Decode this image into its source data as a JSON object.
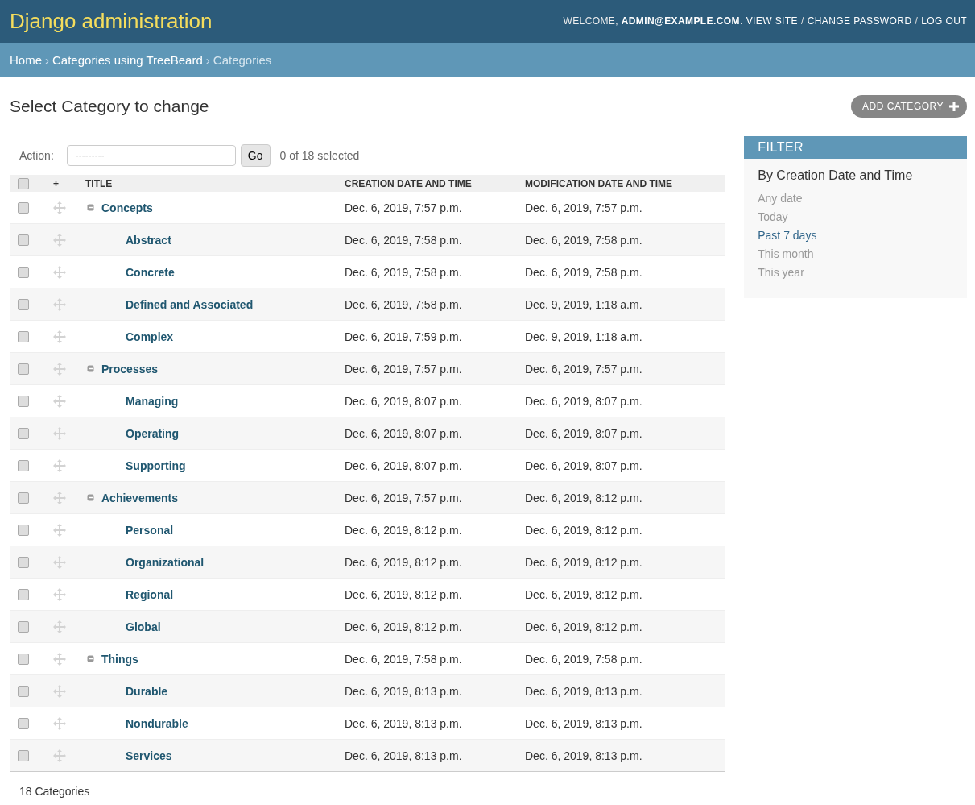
{
  "header": {
    "brand": "Django administration",
    "welcome": "WELCOME,",
    "user": "ADMIN@EXAMPLE.COM",
    "user_end": ".",
    "links": [
      "VIEW SITE",
      "CHANGE PASSWORD",
      "LOG OUT"
    ],
    "separators": [
      "/",
      "/"
    ]
  },
  "breadcrumbs": [
    "Home",
    "Categories using TreeBeard",
    "Categories"
  ],
  "breadcrumb_separators": [
    "›",
    "›"
  ],
  "page_title": "Select Category to change",
  "add_button": "ADD CATEGORY",
  "actions": {
    "label": "Action:",
    "value": "---------",
    "go": "Go",
    "counter": "0 of 18 selected"
  },
  "table": {
    "columns": [
      {
        "label": "+"
      },
      {
        "label": "TITLE"
      },
      {
        "label": "CREATION DATE AND TIME"
      },
      {
        "label": "MODIFICATION DATE AND TIME"
      }
    ],
    "all_checked": false,
    "rows": [
      {
        "title": "Concepts",
        "created": "Dec. 6, 2019, 7:57 p.m.",
        "modified": "Dec. 6, 2019, 7:57 p.m.",
        "checked": false,
        "expanded": true,
        "children": [
          {
            "title": "Abstract",
            "created": "Dec. 6, 2019, 7:58 p.m.",
            "modified": "Dec. 6, 2019, 7:58 p.m.",
            "checked": false
          },
          {
            "title": "Concrete",
            "created": "Dec. 6, 2019, 7:58 p.m.",
            "modified": "Dec. 6, 2019, 7:58 p.m.",
            "checked": false
          },
          {
            "title": "Defined and Associated",
            "created": "Dec. 6, 2019, 7:58 p.m.",
            "modified": "Dec. 9, 2019, 1:18 a.m.",
            "checked": false
          },
          {
            "title": "Complex",
            "created": "Dec. 6, 2019, 7:59 p.m.",
            "modified": "Dec. 9, 2019, 1:18 a.m.",
            "checked": false
          }
        ]
      },
      {
        "title": "Processes",
        "created": "Dec. 6, 2019, 7:57 p.m.",
        "modified": "Dec. 6, 2019, 7:57 p.m.",
        "checked": false,
        "expanded": true,
        "children": [
          {
            "title": "Managing",
            "created": "Dec. 6, 2019, 8:07 p.m.",
            "modified": "Dec. 6, 2019, 8:07 p.m.",
            "checked": false
          },
          {
            "title": "Operating",
            "created": "Dec. 6, 2019, 8:07 p.m.",
            "modified": "Dec. 6, 2019, 8:07 p.m.",
            "checked": false
          },
          {
            "title": "Supporting",
            "created": "Dec. 6, 2019, 8:07 p.m.",
            "modified": "Dec. 6, 2019, 8:07 p.m.",
            "checked": false
          }
        ]
      },
      {
        "title": "Achievements",
        "created": "Dec. 6, 2019, 7:57 p.m.",
        "modified": "Dec. 6, 2019, 8:12 p.m.",
        "checked": false,
        "expanded": true,
        "children": [
          {
            "title": "Personal",
            "created": "Dec. 6, 2019, 8:12 p.m.",
            "modified": "Dec. 6, 2019, 8:12 p.m.",
            "checked": false
          },
          {
            "title": "Organizational",
            "created": "Dec. 6, 2019, 8:12 p.m.",
            "modified": "Dec. 6, 2019, 8:12 p.m.",
            "checked": false
          },
          {
            "title": "Regional",
            "created": "Dec. 6, 2019, 8:12 p.m.",
            "modified": "Dec. 6, 2019, 8:12 p.m.",
            "checked": false
          },
          {
            "title": "Global",
            "created": "Dec. 6, 2019, 8:12 p.m.",
            "modified": "Dec. 6, 2019, 8:12 p.m.",
            "checked": false
          }
        ]
      },
      {
        "title": "Things",
        "created": "Dec. 6, 2019, 7:58 p.m.",
        "modified": "Dec. 6, 2019, 7:58 p.m.",
        "checked": false,
        "expanded": true,
        "children": [
          {
            "title": "Durable",
            "created": "Dec. 6, 2019, 8:13 p.m.",
            "modified": "Dec. 6, 2019, 8:13 p.m.",
            "checked": false
          },
          {
            "title": "Nondurable",
            "created": "Dec. 6, 2019, 8:13 p.m.",
            "modified": "Dec. 6, 2019, 8:13 p.m.",
            "checked": false
          },
          {
            "title": "Services",
            "created": "Dec. 6, 2019, 8:13 p.m.",
            "modified": "Dec. 6, 2019, 8:13 p.m.",
            "checked": false
          }
        ]
      }
    ]
  },
  "result_count": "18 Categories",
  "filter": {
    "title": "FILTER",
    "heading": "By Creation Date and Time",
    "options": [
      {
        "label": "Any date",
        "selected": false
      },
      {
        "label": "Today",
        "selected": false
      },
      {
        "label": "Past 7 days",
        "selected": true
      },
      {
        "label": "This month",
        "selected": false
      },
      {
        "label": "This year",
        "selected": false
      }
    ]
  }
}
